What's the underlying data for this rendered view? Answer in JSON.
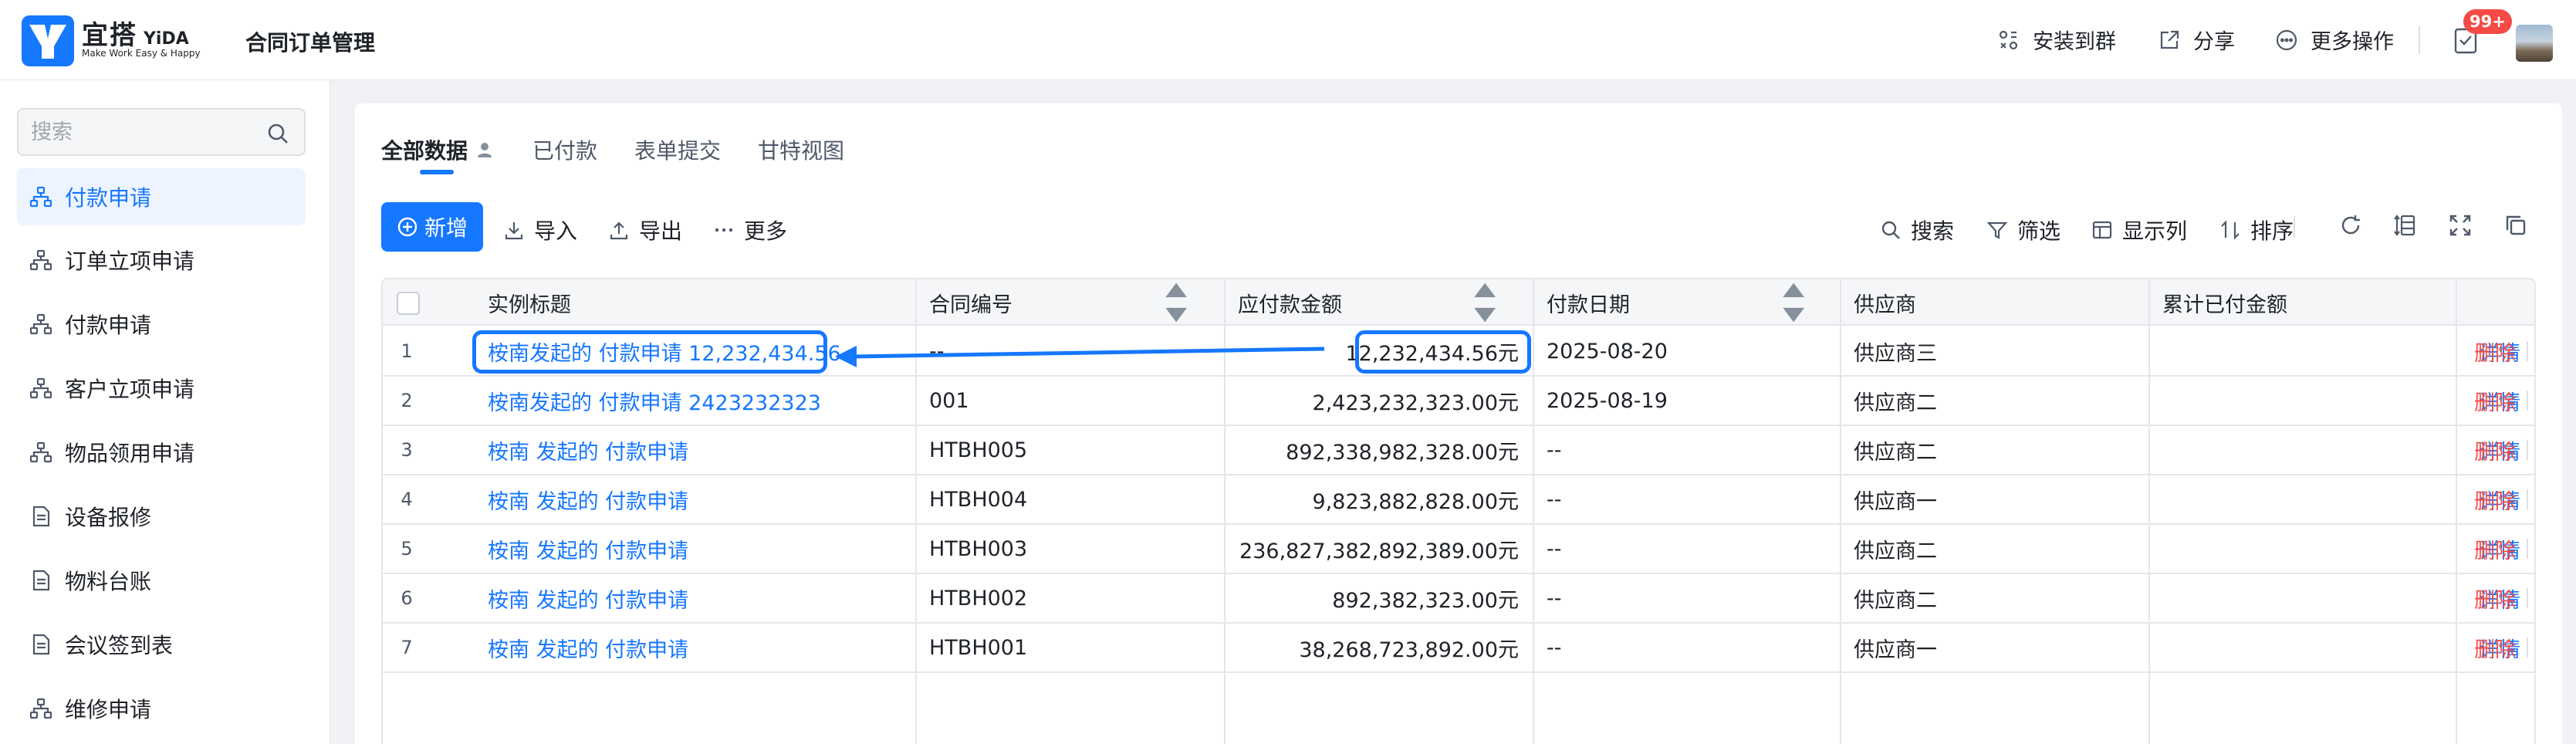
{
  "header": {
    "brand_name": "宜搭",
    "brand_name_en": "YiDA",
    "brand_slogan": "Make Work Easy & Happy",
    "app_title": "合同订单管理",
    "actions": [
      {
        "label": "安装到群",
        "icon": "install-icon"
      },
      {
        "label": "分享",
        "icon": "share-icon"
      },
      {
        "label": "更多操作",
        "icon": "more-circle-icon"
      }
    ],
    "todo_badge": "99+"
  },
  "sidebar": {
    "search_placeholder": "搜索",
    "items": [
      {
        "label": "付款申请",
        "icon": "org-chart-icon",
        "active": true
      },
      {
        "label": "订单立项申请",
        "icon": "org-chart-icon"
      },
      {
        "label": "付款申请",
        "icon": "org-chart-icon"
      },
      {
        "label": "客户立项申请",
        "icon": "org-chart-icon"
      },
      {
        "label": "物品领用申请",
        "icon": "org-chart-icon"
      },
      {
        "label": "设备报修",
        "icon": "document-icon"
      },
      {
        "label": "物料台账",
        "icon": "document-icon"
      },
      {
        "label": "会议签到表",
        "icon": "document-icon"
      },
      {
        "label": "维修申请",
        "icon": "org-chart-icon"
      }
    ]
  },
  "main": {
    "tabs": [
      {
        "label": "全部数据",
        "active": true
      },
      {
        "label": "已付款"
      },
      {
        "label": "表单提交"
      },
      {
        "label": "甘特视图"
      }
    ],
    "toolbar": {
      "add_label": "新增",
      "import_label": "导入",
      "export_label": "导出",
      "more_label": "更多",
      "search_label": "搜索",
      "filter_label": "筛选",
      "columns_label": "显示列",
      "sort_label": "排序"
    },
    "table": {
      "columns": [
        "实例标题",
        "合同编号",
        "应付款金额",
        "付款日期",
        "供应商",
        "累计已付金额"
      ],
      "detail_label": "详情",
      "delete_label": "删除",
      "rows": [
        {
          "index": "1",
          "title": "桉南发起的 付款申请 12,232,434.56",
          "contract": "--",
          "amount": "12,232,434.56元",
          "date": "2025-08-20",
          "supplier": "供应商三",
          "paid": ""
        },
        {
          "index": "2",
          "title": "桉南发起的 付款申请 2423232323",
          "contract": "001",
          "amount": "2,423,232,323.00元",
          "date": "2025-08-19",
          "supplier": "供应商二",
          "paid": ""
        },
        {
          "index": "3",
          "title": "桉南 发起的 付款申请",
          "contract": "HTBH005",
          "amount": "892,338,982,328.00元",
          "date": "--",
          "supplier": "供应商二",
          "paid": ""
        },
        {
          "index": "4",
          "title": "桉南 发起的 付款申请",
          "contract": "HTBH004",
          "amount": "9,823,882,828.00元",
          "date": "--",
          "supplier": "供应商一",
          "paid": ""
        },
        {
          "index": "5",
          "title": "桉南 发起的 付款申请",
          "contract": "HTBH003",
          "amount": "236,827,382,892,389.00元",
          "date": "--",
          "supplier": "供应商二",
          "paid": ""
        },
        {
          "index": "6",
          "title": "桉南 发起的 付款申请",
          "contract": "HTBH002",
          "amount": "892,382,323.00元",
          "date": "--",
          "supplier": "供应商二",
          "paid": ""
        },
        {
          "index": "7",
          "title": "桉南 发起的 付款申请",
          "contract": "HTBH001",
          "amount": "38,268,723,892.00元",
          "date": "--",
          "supplier": "供应商一",
          "paid": ""
        }
      ]
    }
  },
  "colors": {
    "accent": "#1677ff",
    "danger": "#f54a45",
    "badge": "#f54a45"
  }
}
